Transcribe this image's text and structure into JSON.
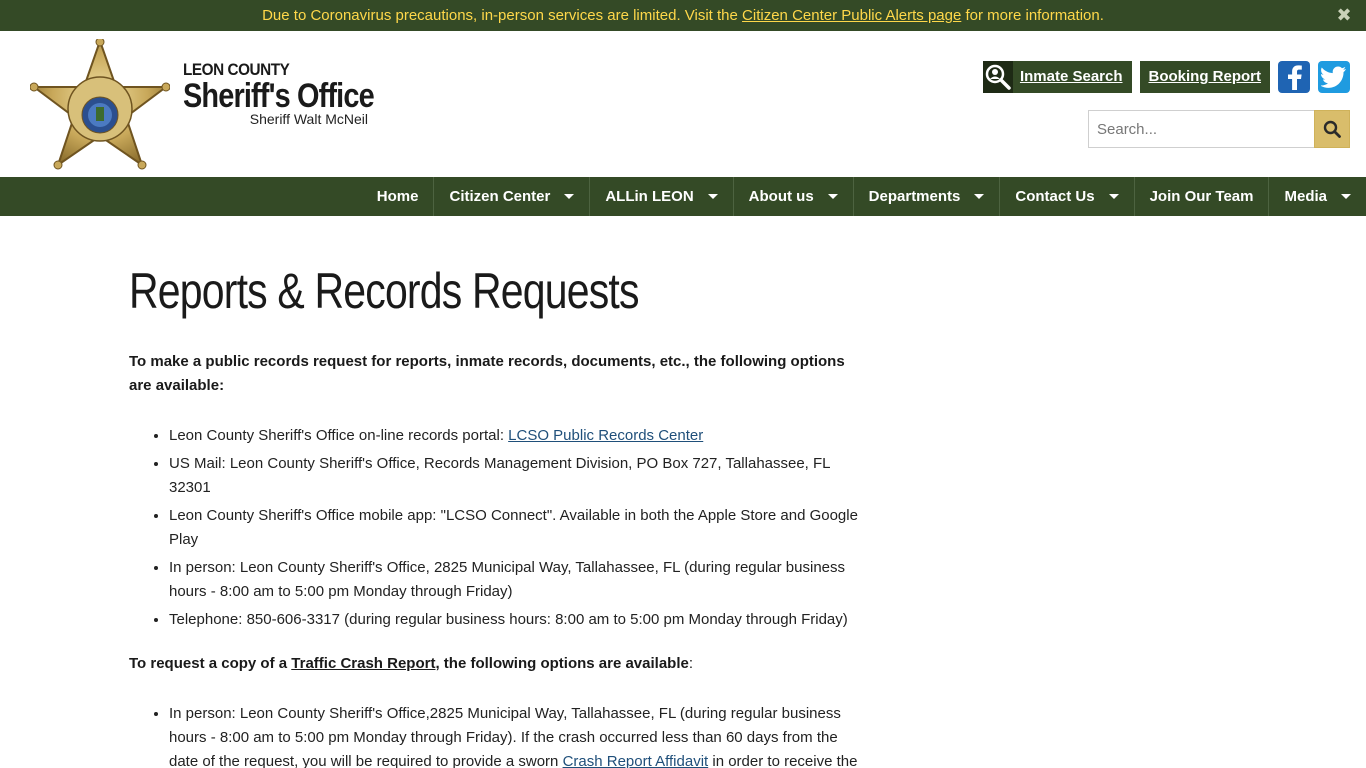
{
  "alert": {
    "text_before": "Due to Coronavirus precautions, in-person services are limited. Visit the ",
    "link": "Citizen Center Public Alerts page",
    "text_after": " for more information.",
    "close": "✖"
  },
  "brand": {
    "top": "LEON COUNTY",
    "main": "Sheriff's Office",
    "sub": "Sheriff Walt McNeil"
  },
  "actions": {
    "inmate_search": "Inmate Search",
    "booking_report": "Booking Report"
  },
  "search": {
    "placeholder": "Search..."
  },
  "nav": [
    {
      "label": "Home"
    },
    {
      "label": "Citizen Center"
    },
    {
      "label": "ALLin LEON"
    },
    {
      "label": "About us"
    },
    {
      "label": "Departments"
    },
    {
      "label": "Contact Us"
    },
    {
      "label": "Join Our Team"
    },
    {
      "label": "Media"
    }
  ],
  "content": {
    "title": "Reports & Records Requests",
    "intro": "To make a public records request for reports, inmate records, documents, etc., the following options are available:",
    "options": [
      {
        "text": "Leon County Sheriff's Office on-line records portal: ",
        "link": "LCSO Public Records Center"
      },
      {
        "text": "US Mail: Leon County Sheriff's Office, Records Management Division, PO Box 727, Tallahassee, FL 32301"
      },
      {
        "text": "Leon County Sheriff's Office mobile app: \"LCSO Connect\". Available in both the Apple Store and Google Play"
      },
      {
        "text": "In person: Leon County Sheriff's Office, 2825 Municipal Way, Tallahassee, FL (during regular business hours - 8:00 am to 5:00 pm Monday through Friday)"
      },
      {
        "text": "Telephone: 850-606-3317 (during regular business hours: 8:00 am to 5:00 pm Monday through Friday)"
      }
    ],
    "crash_intro_before": "To request a copy of a ",
    "crash_intro_link": "Traffic Crash Report",
    "crash_intro_after": ", the following options are available",
    "crash_intro_colon": ":",
    "crash_options": [
      {
        "text_before": "In person: Leon County Sheriff's Office,2825 Municipal Way, Tallahassee, FL (during regular business hours - 8:00 am to 5:00 pm Monday through Friday). If the crash occurred less than 60 days from the date of the request, you will be required to provide a sworn ",
        "link": "Crash Report Affidavit",
        "text_after": " in order to receive the report. If you are submitting your request in person, you do not need to have the Affidavit notarized"
      }
    ]
  },
  "colors": {
    "green": "#344a26",
    "gold": "#ffd84a",
    "search_btn": "#d9bd6b",
    "facebook": "#1f64b3",
    "twitter": "#1f9be0"
  },
  "icons": [
    "close-icon",
    "sheriff-star-badge",
    "magnifier-person-icon",
    "facebook-icon",
    "twitter-icon",
    "search-icon",
    "caret-down-icon"
  ]
}
